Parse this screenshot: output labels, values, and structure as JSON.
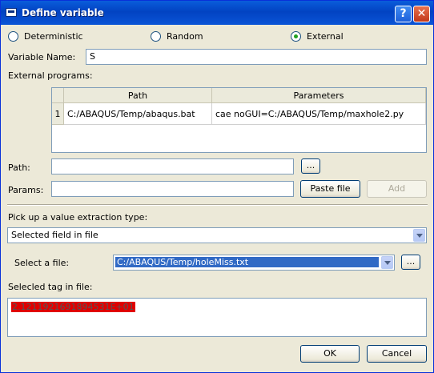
{
  "window": {
    "title": "Define variable",
    "help_label": "?",
    "close_label": "✕"
  },
  "variable_type": {
    "options": [
      {
        "label": "Deterministic",
        "selected": false
      },
      {
        "label": "Random",
        "selected": false
      },
      {
        "label": "External",
        "selected": true
      }
    ]
  },
  "variable_name": {
    "label": "Variable Name:",
    "value": "S"
  },
  "external_programs": {
    "label": "External programs:",
    "columns": [
      "Path",
      "Parameters"
    ],
    "rows": [
      {
        "index": "1",
        "path": "C:/ABAQUS/Temp/abaqus.bat",
        "parameters": "cae noGUI=C:/ABAQUS/Temp/maxhole2.py"
      }
    ]
  },
  "path_field": {
    "label": "Path:",
    "value": "",
    "browse_label": "..."
  },
  "params_field": {
    "label": "Params:",
    "value": "",
    "paste_label": "Paste file",
    "add_label": "Add"
  },
  "extraction": {
    "label": "Pick up a value extraction type:",
    "selected": "Selected field in file"
  },
  "file_select": {
    "label": "Select a file:",
    "value": "C:/ABAQUS/Temp/holeMiss.txt",
    "browse_label": "..."
  },
  "selected_tag": {
    "label": "Selecled tag in file:",
    "value": "2.1211921691894531E+01"
  },
  "footer": {
    "ok_label": "OK",
    "cancel_label": "Cancel"
  },
  "colors": {
    "title_bar": "#0a5ddb",
    "selection": "#316ac5",
    "tag_highlight": "#e00000"
  }
}
